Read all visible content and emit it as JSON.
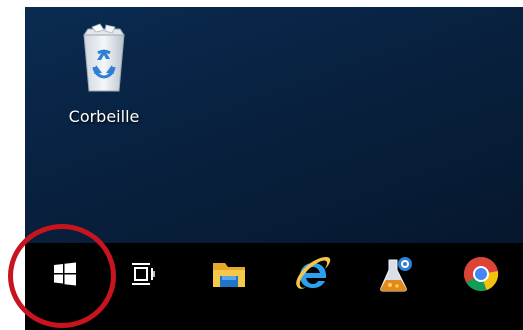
{
  "desktop": {
    "background_color": "#08213f",
    "icons": [
      {
        "label": "Corbeille",
        "icon": "recycle-bin-icon"
      }
    ]
  },
  "taskbar": {
    "background_color": "#000000",
    "buttons": [
      {
        "icon": "windows-logo-icon"
      },
      {
        "icon": "task-view-icon"
      },
      {
        "icon": "file-explorer-icon"
      },
      {
        "icon": "internet-explorer-icon"
      },
      {
        "icon": "lab-flask-icon"
      },
      {
        "icon": "chrome-icon"
      }
    ]
  },
  "annotation": {
    "highlight_color": "#c8141e",
    "highlight_target": "start-button"
  }
}
